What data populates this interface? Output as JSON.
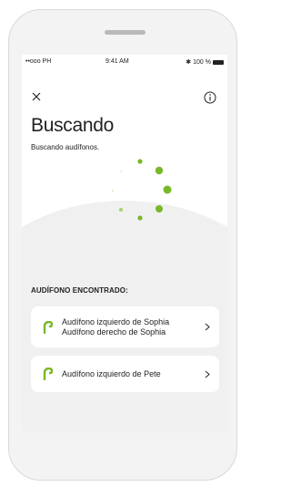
{
  "status_bar": {
    "carrier": "••ooo PH",
    "time": "9:41 AM",
    "battery": "100 %"
  },
  "header": {
    "title": "Buscando",
    "subtitle": "Buscando audífonos."
  },
  "section": {
    "label": "AUDÍFONO ENCONTRADO:"
  },
  "devices": [
    {
      "line1": "Audífono izquierdo de Sophia",
      "line2": "Audífono derecho de Sophia"
    },
    {
      "line1": "Audífono izquierdo de Pete"
    }
  ],
  "colors": {
    "accent": "#79b82a",
    "background": "#f0f0f0",
    "card": "#ffffff",
    "text": "#222222"
  },
  "icons": {
    "close": "close-icon",
    "info": "info-icon",
    "device": "hearing-aid-icon",
    "chevron": "chevron-right-icon"
  }
}
